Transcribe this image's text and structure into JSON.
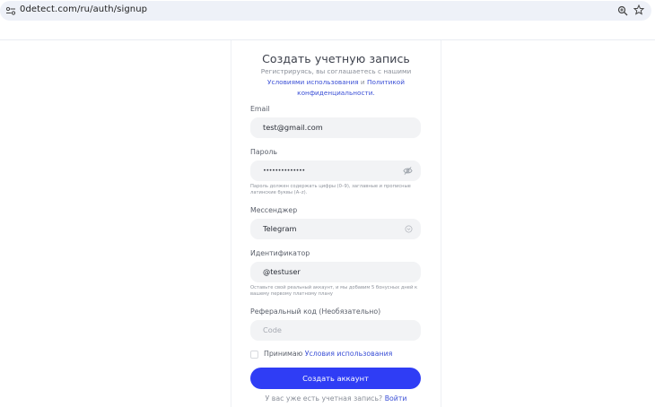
{
  "browser": {
    "url": "0detect.com/ru/auth/signup"
  },
  "form": {
    "title": "Создать учетную запись",
    "subtitle_prefix": "Регистрируясь, вы соглашаетесь с нашими",
    "terms_link": "Условиями использования",
    "subtitle_and": "и",
    "privacy_link": "Политикой конфиденциальности.",
    "email": {
      "label": "Email",
      "value": "test@gmail.com"
    },
    "password": {
      "label": "Пароль",
      "value": "••••••••••••••",
      "hint": "Пароль должен содержать цифры (0–9), заглавные и прописные латинские буквы (A–z)."
    },
    "messenger": {
      "label": "Мессенджер",
      "value": "Telegram"
    },
    "identifier": {
      "label": "Идентификатор",
      "value": "@testuser",
      "hint": "Оставьте свой реальный аккаунт, и мы добавим 5 бонусных дней к вашему первому платному плану"
    },
    "referral": {
      "label": "Реферальный код (Необязательно)",
      "placeholder": "Code"
    },
    "accept_prefix": "Принимаю",
    "accept_link": "Условия использования",
    "submit_label": "Создать аккаунт",
    "login_prompt": "У вас уже есть учетная запись?",
    "login_link": "Войти"
  },
  "colors": {
    "accent": "#2f3df5",
    "link": "#3a4fd6",
    "field_bg": "#f2f3f5"
  },
  "icons": {
    "site": "site-settings-icon",
    "zoom": "zoom-icon",
    "bookmark": "star-icon",
    "password_toggle": "eye-off-icon",
    "messenger_select": "chevron-icon"
  }
}
